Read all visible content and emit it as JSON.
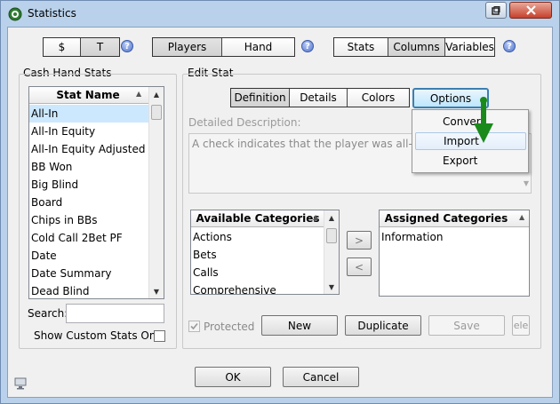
{
  "window": {
    "title": "Statistics"
  },
  "toolbar": {
    "currency": [
      {
        "label": "$"
      },
      {
        "label": "T"
      }
    ],
    "mode": [
      {
        "label": "Players"
      },
      {
        "label": "Hand"
      }
    ],
    "view": [
      {
        "label": "Stats"
      },
      {
        "label": "Columns"
      },
      {
        "label": "Variables"
      }
    ]
  },
  "left": {
    "group_label": "Cash Hand Stats",
    "column_header": "Stat Name",
    "items": [
      "All-In",
      "All-In Equity",
      "All-In Equity Adjusted BB",
      "BB Won",
      "Big Blind",
      "Board",
      "Chips in BBs",
      "Cold Call 2Bet PF",
      "Date",
      "Date Summary",
      "Dead Blind"
    ],
    "search_label": "Search:",
    "search_value": "",
    "custom_only_label": "Show Custom Stats Only"
  },
  "edit": {
    "group_label": "Edit Stat",
    "tabs": [
      {
        "label": "Definition"
      },
      {
        "label": "Details"
      },
      {
        "label": "Colors"
      }
    ],
    "options_label": "Options",
    "description_label": "Detailed Description:",
    "description_text": "A check indicates that the player was all-in at so... hand.",
    "available_header": "Available Categories",
    "available_items": [
      "Actions",
      "Bets",
      "Calls",
      "Comprehensive"
    ],
    "assigned_header": "Assigned Categories",
    "assigned_items": [
      "Information"
    ],
    "move_right": ">",
    "move_left": "<",
    "protected_label": "Protected",
    "new_label": "New",
    "duplicate_label": "Duplicate",
    "save_label": "Save",
    "delete_label": "ele"
  },
  "menu": {
    "items": [
      "Convert",
      "Import",
      "Export"
    ]
  },
  "footer": {
    "ok_label": "OK",
    "cancel_label": "Cancel"
  },
  "colors": {
    "accent_arrow": "#1a8a1a",
    "selection": "#cce8ff",
    "window_frame": "#b9d1ea"
  }
}
